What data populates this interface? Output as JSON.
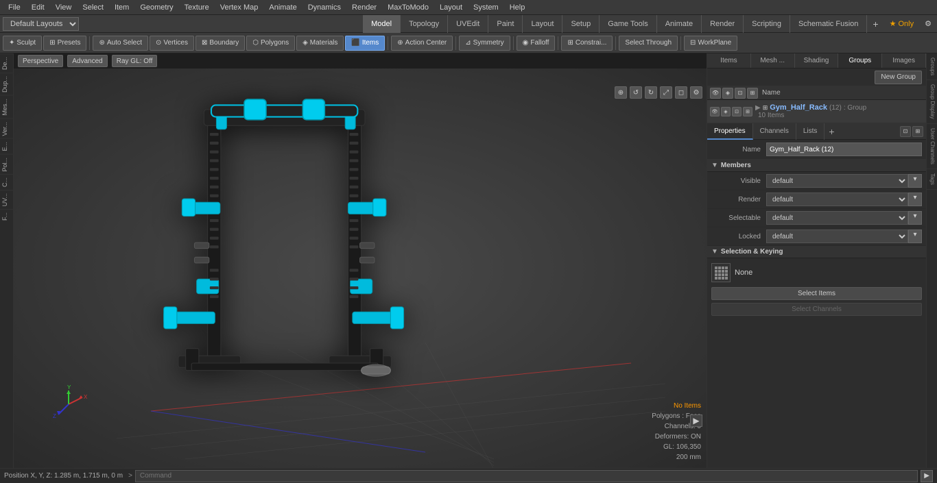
{
  "menubar": {
    "items": [
      "File",
      "Edit",
      "View",
      "Select",
      "Item",
      "Geometry",
      "Texture",
      "Vertex Map",
      "Animate",
      "Dynamics",
      "Render",
      "MaxToModo",
      "Layout",
      "System",
      "Help"
    ]
  },
  "layout_bar": {
    "dropdown_label": "Default Layouts ▾",
    "tabs": [
      "Model",
      "Topology",
      "UVEdit",
      "Paint",
      "Layout",
      "Setup",
      "Game Tools",
      "Animate",
      "Render",
      "Scripting",
      "Schematic Fusion"
    ],
    "active_tab": "Model",
    "add_icon": "+",
    "star_label": "★ Only",
    "gear_label": "⚙"
  },
  "toolbar": {
    "left_buttons": [
      "Sculpt",
      "Presets"
    ],
    "mode_buttons": [
      "Auto Select",
      "Vertices",
      "Boundary",
      "Polygons",
      "Materials",
      "Items",
      "Action Center",
      "Symmetry",
      "Falloff",
      "Constrai..."
    ],
    "active_mode": "Items",
    "right_buttons": [
      "Select Through",
      "WorkPlane"
    ]
  },
  "left_sidebar": {
    "tabs": [
      "De...",
      "Dup...",
      "Mes...",
      "Ver...",
      "E...",
      "Pol...",
      "C...",
      "UV...",
      "F..."
    ]
  },
  "viewport": {
    "perspective_label": "Perspective",
    "advanced_label": "Advanced",
    "raygl_label": "Ray GL: Off",
    "icons": [
      "⊕",
      "↺",
      "↻",
      "⤢",
      "◻",
      "⚙"
    ]
  },
  "viewport_info": {
    "no_items": "No Items",
    "polygons": "Polygons : Face",
    "channels": "Channels: 0",
    "deformers": "Deformers: ON",
    "gl": "GL: 106,350",
    "size": "200 mm"
  },
  "right_panel": {
    "top_tabs": [
      "Items",
      "Mesh ...",
      "Shading",
      "Groups",
      "Images"
    ],
    "active_top_tab": "Groups",
    "new_group_btn": "New Group",
    "list_header": {
      "name_col": "Name"
    },
    "group_item": {
      "name": "Gym_Half_Rack",
      "count_label": "(12)",
      "type_label": ": Group",
      "sub_items": "10 Items"
    }
  },
  "properties": {
    "tabs": [
      "Properties",
      "Channels",
      "Lists"
    ],
    "active_tab": "Properties",
    "add_tab": "+",
    "name_label": "Name",
    "name_value": "Gym_Half_Rack (12)",
    "members_label": "Members",
    "visible_label": "Visible",
    "visible_value": "default",
    "render_label": "Render",
    "render_value": "default",
    "selectable_label": "Selectable",
    "selectable_value": "default",
    "locked_label": "Locked",
    "locked_value": "default",
    "selection_keying_label": "Selection & Keying",
    "none_label": "None",
    "select_items_label": "Select Items",
    "select_channels_label": "Select Channels"
  },
  "right_vtabs": {
    "tabs": [
      "Groups",
      "Group Display",
      "User Channels",
      "Tags"
    ]
  },
  "status_bar": {
    "position_label": "Position X, Y, Z:",
    "position_value": "1.285 m, 1.715 m, 0 m",
    "command_prompt": ">",
    "command_placeholder": "Command",
    "run_btn": "▶"
  }
}
